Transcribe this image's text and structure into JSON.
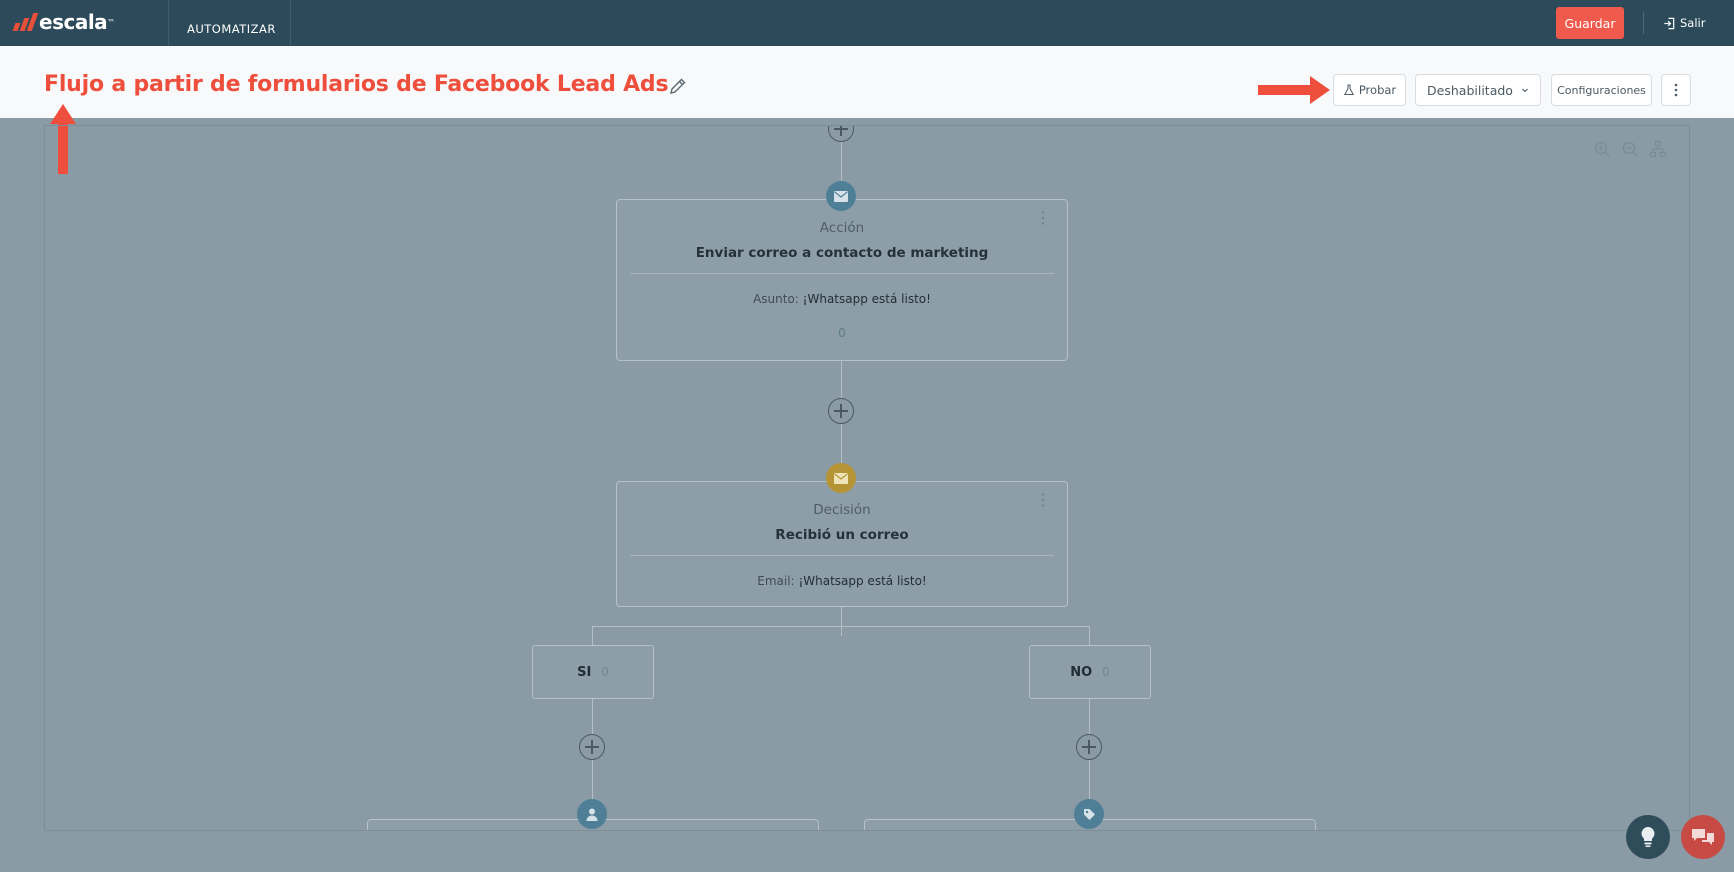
{
  "nav": {
    "brand": "escala",
    "brand_tm": "™",
    "tab": "AUTOMATIZAR",
    "save_label": "Guardar",
    "exit_label": "Salir"
  },
  "header": {
    "title": "Flujo a partir de formularios de Facebook Lead Ads",
    "test_label": "Probar",
    "status_label": "Deshabilitado",
    "config_label": "Configuraciones"
  },
  "flow": {
    "action_node": {
      "kind": "Acción",
      "title": "Enviar correo a contacto de marketing",
      "detail_label": "Asunto:",
      "detail_value": "¡Whatsapp está listo!",
      "count": "0"
    },
    "decision_node": {
      "kind": "Decisión",
      "title": "Recibió un correo",
      "detail_label": "Email:",
      "detail_value": "¡Whatsapp está listo!"
    },
    "branch_yes": {
      "label": "SI",
      "count": "0"
    },
    "branch_no": {
      "label": "NO",
      "count": "0"
    }
  },
  "icons": {
    "action": "mail-icon",
    "decision": "mail-icon",
    "yes_next": "user-icon",
    "no_next": "tag-icon"
  },
  "colors": {
    "nav_bg": "#2d4a5a",
    "accent": "#ee4f3c",
    "save_button": "#ef5a4d",
    "action_icon": "#4f7f96",
    "decision_icon": "#b49434",
    "overlay": "#8a9ba5"
  }
}
